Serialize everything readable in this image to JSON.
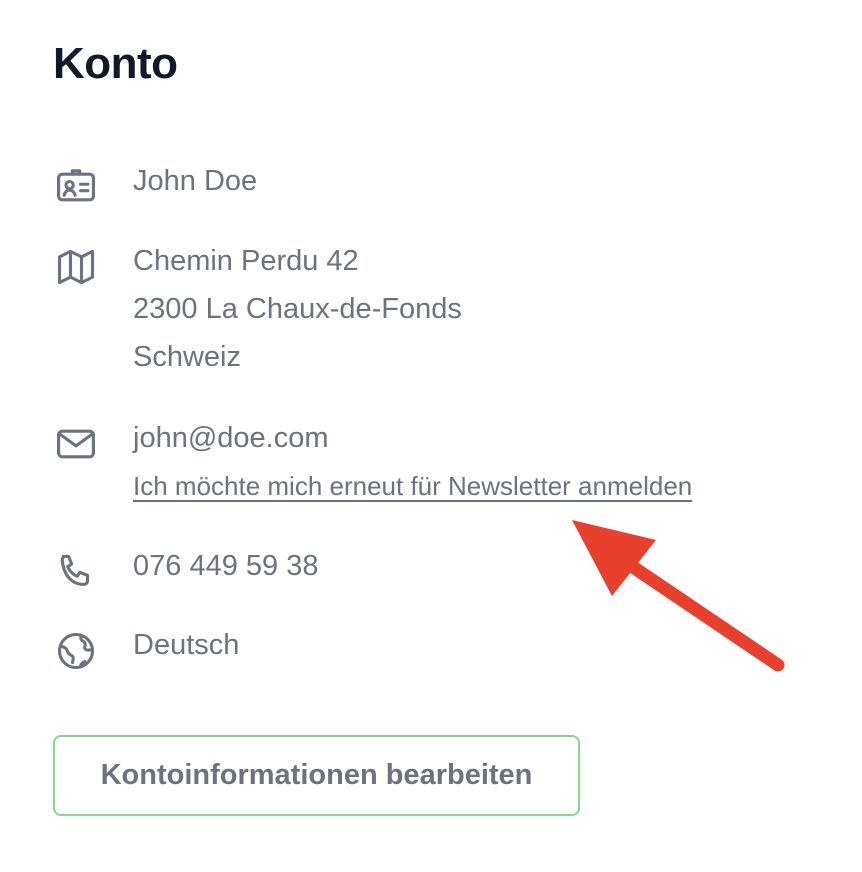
{
  "page": {
    "title": "Konto"
  },
  "account": {
    "name": "John Doe",
    "address": {
      "street": "Chemin Perdu 42",
      "city": "2300 La Chaux-de-Fonds",
      "country": "Schweiz"
    },
    "email": "john@doe.com",
    "newsletter_link": "Ich möchte mich erneut für Newsletter anmelden",
    "phone": "076 449 59 38",
    "language": "Deutsch"
  },
  "actions": {
    "edit_button_label": "Kontoinformationen bearbeiten"
  },
  "icons": {
    "name": "id-card-icon",
    "address": "map-icon",
    "email": "envelope-icon",
    "phone": "phone-icon",
    "language": "globe-icon",
    "annotation": "red-arrow"
  },
  "colors": {
    "title": "#111827",
    "text": "#6b7280",
    "button_border": "#86d98f",
    "arrow": "#e8402c"
  }
}
